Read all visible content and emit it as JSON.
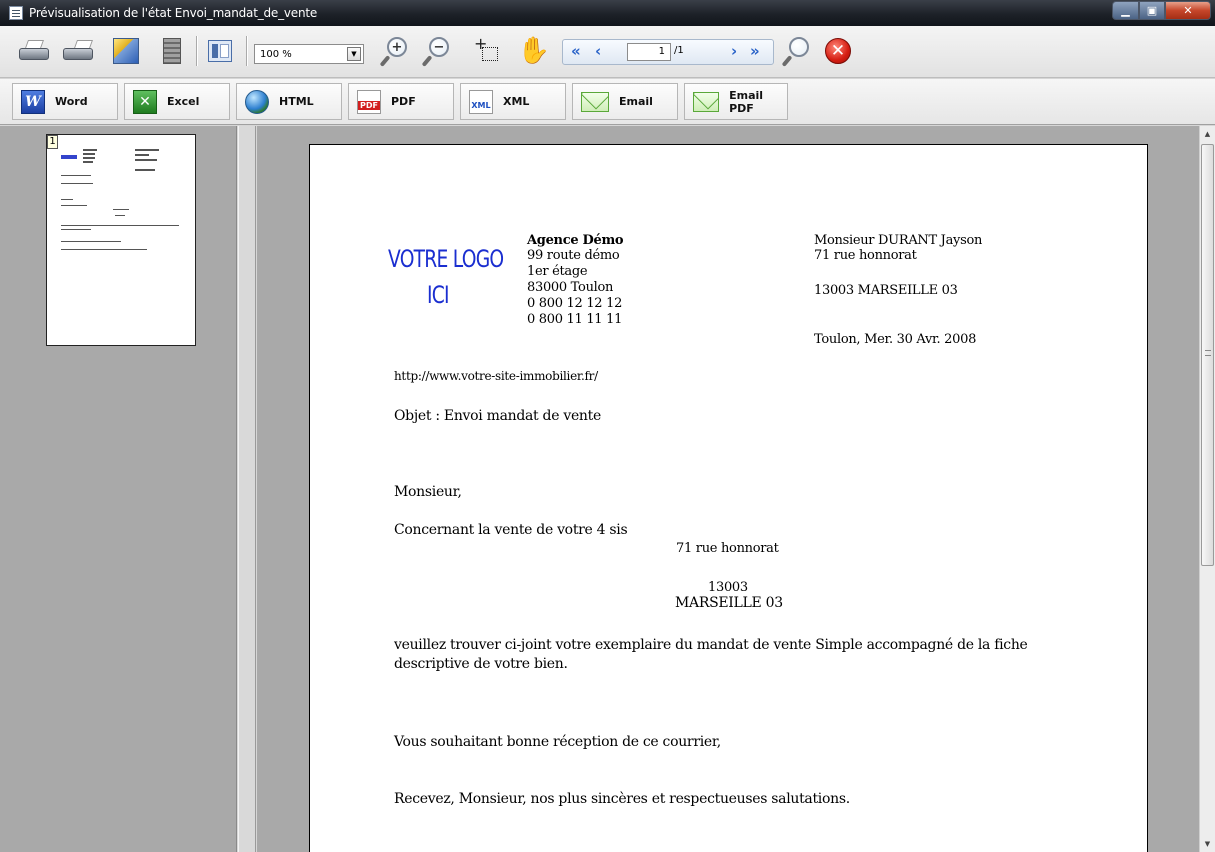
{
  "window": {
    "title": "Prévisualisation de l'état Envoi_mandat_de_vente",
    "minimize_icon": "minimize-icon",
    "maximize_icon": "maximize-icon",
    "close_icon": "close-icon"
  },
  "toolbar": {
    "zoom_value": "100 %",
    "page_current": "1",
    "page_total": "/1",
    "icons": [
      "printer-icon",
      "printer-setup-icon",
      "page-setup-icon",
      "calculator-icon",
      "thumbnail-view-icon",
      "zoom-in-icon",
      "zoom-out-icon",
      "select-area-icon",
      "hand-pan-icon",
      "first-page-icon",
      "previous-page-icon",
      "next-page-icon",
      "last-page-icon",
      "search-icon",
      "close-preview-icon"
    ]
  },
  "export_bar": {
    "buttons": [
      {
        "label": "Word",
        "icon": "word-icon"
      },
      {
        "label": "Excel",
        "icon": "excel-icon"
      },
      {
        "label": "HTML",
        "icon": "globe-icon"
      },
      {
        "label": "PDF",
        "icon": "pdf-icon"
      },
      {
        "label": "XML",
        "icon": "xml-icon"
      },
      {
        "label": "Email",
        "icon": "envelope-icon"
      },
      {
        "label": "Email PDF",
        "icon": "email-pdf-icon"
      }
    ]
  },
  "thumbnails": {
    "page_number": "1"
  },
  "document": {
    "logo_line1": "VOTRE LOGO",
    "logo_line2": "ICI",
    "agency": {
      "name": "Agence Démo",
      "address1": "99 route démo",
      "address2": "1er étage",
      "city": "83000 Toulon",
      "phone1": "0 800 12 12 12",
      "phone2": "0 800 11 11 11"
    },
    "recipient": {
      "name": "Monsieur DURANT Jayson",
      "street": "71 rue honnorat",
      "city": "13003 MARSEILLE 03"
    },
    "date_line": "Toulon, Mer. 30 Avr. 2008",
    "website": "http://www.votre-site-immobilier.fr/",
    "subject": "Objet : Envoi mandat de vente",
    "salutation": "Monsieur,",
    "intro": "Concernant la vente de votre  4 sis",
    "property_street": "71 rue honnorat",
    "property_zip": "13003",
    "property_city": "MARSEILLE 03",
    "body_line1": "veuillez trouver ci-joint votre exemplaire du mandat de vente Simple accompagné de la fiche",
    "body_line2": "descriptive de votre bien.",
    "closing1": "Vous souhaitant bonne réception de ce courrier,",
    "closing2": "Recevez, Monsieur, nos plus sincères et respectueuses salutations."
  }
}
